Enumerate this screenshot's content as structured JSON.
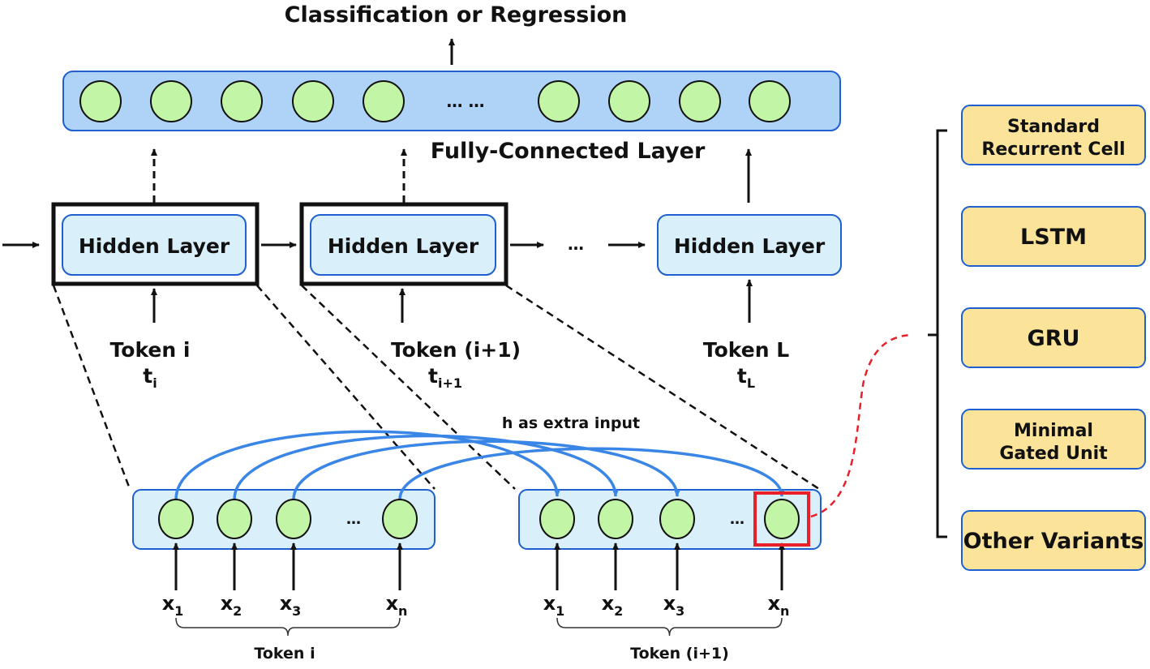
{
  "title": "Classification or Regression",
  "fc_layer": {
    "label": "Fully-Connected Layer",
    "ellipsis": "… …",
    "left_nodes": 5,
    "right_nodes": 4
  },
  "hidden_layers": [
    {
      "label": "Hidden Layer",
      "token": "Token i",
      "sym": "t",
      "sub": "i",
      "highlighted": true
    },
    {
      "label": "Hidden Layer",
      "token": "Token (i+1)",
      "sym": "t",
      "sub": "i+1",
      "highlighted": true
    },
    {
      "label": "Hidden Layer",
      "token": "Token L",
      "sym": "t",
      "sub": "L",
      "highlighted": false
    }
  ],
  "chain_ellipsis": "…",
  "extra_input_label": "h as extra input",
  "token_groups": [
    {
      "label": "Token i",
      "inputs": [
        {
          "sym": "x",
          "sub": "1"
        },
        {
          "sym": "x",
          "sub": "2"
        },
        {
          "sym": "x",
          "sub": "3"
        },
        {
          "sym": "x",
          "sub": "n"
        }
      ],
      "ellipsis": "…"
    },
    {
      "label": "Token (i+1)",
      "inputs": [
        {
          "sym": "x",
          "sub": "1"
        },
        {
          "sym": "x",
          "sub": "2"
        },
        {
          "sym": "x",
          "sub": "3"
        },
        {
          "sym": "x",
          "sub": "n"
        }
      ],
      "ellipsis": "…"
    }
  ],
  "cell_variants": [
    [
      "Standard",
      "Recurrent Cell"
    ],
    [
      "LSTM"
    ],
    [
      "GRU"
    ],
    [
      "Minimal",
      "Gated Unit"
    ],
    [
      "Other Variants"
    ]
  ],
  "colors": {
    "fc_fill": "#aed3f7",
    "hidden_fill": "#d9f0fb",
    "box_border": "#1f5fd0",
    "node_fill": "#c3f5a6",
    "curve": "#3a86e6",
    "highlight": "#e8202a",
    "variant_fill": "#fbe49a"
  }
}
